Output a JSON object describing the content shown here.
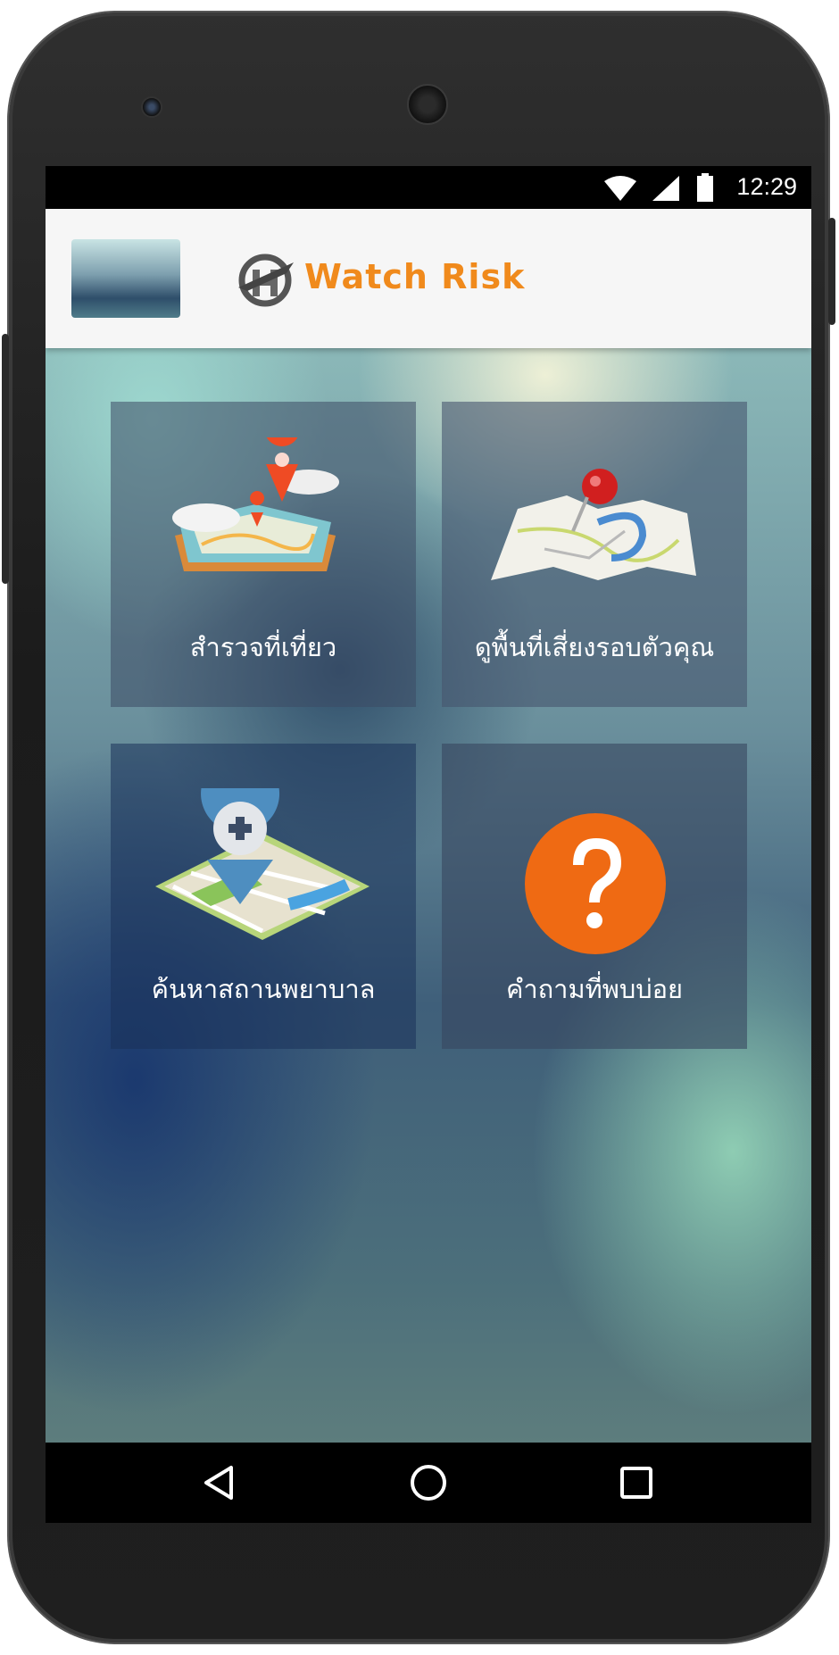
{
  "status_bar": {
    "time": "12:29",
    "icons": [
      "wifi-icon",
      "cell-signal-icon",
      "battery-icon"
    ]
  },
  "app_bar": {
    "brand": "Watch Risk",
    "brand_color": "#f08a1c",
    "logo_icon": "globe-plane-logo",
    "thumbnail": "landscape-thumbnail"
  },
  "menu": {
    "tiles": [
      {
        "label": "สำรวจที่เที่ยว",
        "icon": "map-clouds-pin-icon"
      },
      {
        "label": "ดูพื้นที่เสี่ยงรอบตัวคุณ",
        "icon": "map-pushpin-icon"
      },
      {
        "label": "ค้นหาสถานพยาบาล",
        "icon": "hospital-map-pin-icon"
      },
      {
        "label": "คำถามที่พบบ่อย",
        "icon": "question-mark-icon"
      }
    ]
  },
  "nav_bar": {
    "buttons": [
      "back-icon",
      "home-icon",
      "recents-icon"
    ]
  }
}
